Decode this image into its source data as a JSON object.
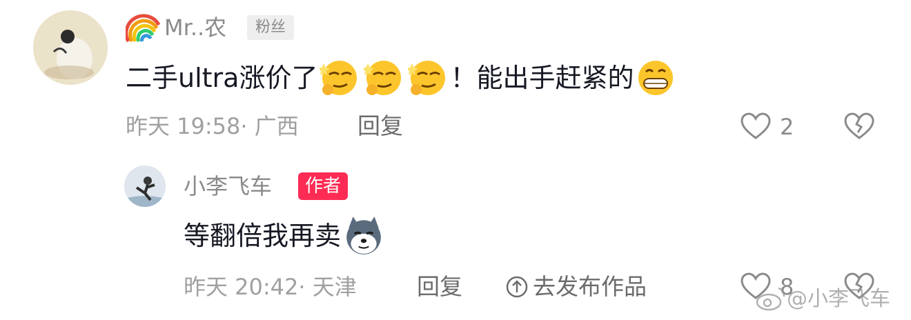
{
  "comment": {
    "username": "Mr..农",
    "badge": "粉丝",
    "text_before": "二手ultra涨价了",
    "text_middle": "！能出手赶紧的",
    "time_location": "昨天 19:58· 广西",
    "reply_label": "回复",
    "like_count": "2"
  },
  "reply": {
    "username": "小李飞车",
    "badge": "作者",
    "text": "等翻倍我再卖",
    "time_location": "昨天 20:42· 天津",
    "reply_label": "回复",
    "publish_label": "去发布作品",
    "like_count": "8"
  },
  "watermark": "@小李飞车",
  "colors": {
    "author_badge": "#fe2c55",
    "text": "#161823",
    "meta": "#a0a0a0"
  }
}
